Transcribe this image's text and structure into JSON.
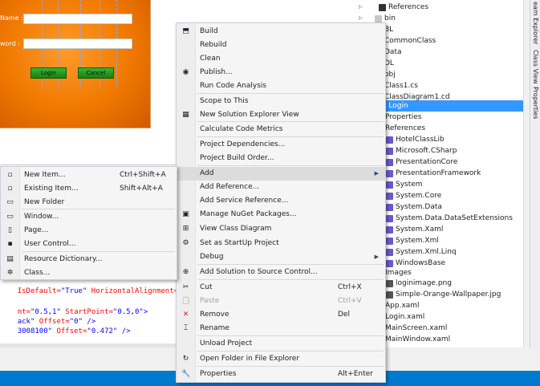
{
  "designer": {
    "name_label": "Name :",
    "password_label": "word :",
    "login_button": "Login",
    "cancel_button": "Cancel"
  },
  "code": {
    "line1_attr": "IsDefault=",
    "line1_val": "\"True\"",
    "line1_attr2": " HorizontalAlignment=",
    "line2_a": "nt=",
    "line2_b": "\"0.5,1\"",
    "line2_c": " StartPoint=",
    "line2_d": "\"0.5,0\"",
    "line2_e": ">",
    "line3_a": "ack\"",
    "line3_b": " Offset=",
    "line3_c": "\"0\"",
    "line3_d": " />",
    "line4_a": "3008100\"",
    "line4_b": " Offset=",
    "line4_c": "\"0.472\"",
    "line4_d": " />"
  },
  "solution_tree": [
    {
      "label": "References",
      "arrow": "right",
      "icon": "references-icon"
    },
    {
      "label": "bin",
      "arrow": "right",
      "icon": "folder-icon"
    },
    {
      "label": "BL",
      "arrow": "",
      "icon": ""
    },
    {
      "label": "CommonClass",
      "arrow": "",
      "icon": ""
    },
    {
      "label": "Data",
      "arrow": "",
      "icon": ""
    },
    {
      "label": "DL",
      "arrow": "",
      "icon": ""
    },
    {
      "label": "obj",
      "arrow": "",
      "icon": ""
    },
    {
      "label": "Class1.cs",
      "arrow": "",
      "icon": ""
    },
    {
      "label": "ClassDiagram1.cd",
      "arrow": "",
      "icon": ""
    },
    {
      "label": "t Login",
      "arrow": "",
      "icon": "",
      "selected": true
    },
    {
      "label": "Properties",
      "arrow": "",
      "icon": ""
    },
    {
      "label": "References",
      "arrow": "",
      "icon": ""
    },
    {
      "label": "HotelClassLib",
      "arrow": "",
      "icon": "reference-icon"
    },
    {
      "label": "Microsoft.CSharp",
      "arrow": "",
      "icon": "reference-icon"
    },
    {
      "label": "PresentationCore",
      "arrow": "",
      "icon": "reference-icon"
    },
    {
      "label": "PresentationFramework",
      "arrow": "",
      "icon": "reference-icon"
    },
    {
      "label": "System",
      "arrow": "",
      "icon": "reference-icon"
    },
    {
      "label": "System.Core",
      "arrow": "",
      "icon": "reference-icon"
    },
    {
      "label": "System.Data",
      "arrow": "",
      "icon": "reference-icon"
    },
    {
      "label": "System.Data.DataSetExtensions",
      "arrow": "",
      "icon": "reference-icon"
    },
    {
      "label": "System.Xaml",
      "arrow": "",
      "icon": "reference-icon"
    },
    {
      "label": "System.Xml",
      "arrow": "",
      "icon": "reference-icon"
    },
    {
      "label": "System.Xml.Linq",
      "arrow": "",
      "icon": "reference-icon"
    },
    {
      "label": "WindowsBase",
      "arrow": "",
      "icon": "reference-icon"
    },
    {
      "label": "Images",
      "arrow": "",
      "icon": ""
    },
    {
      "label": "loginimage.png",
      "arrow": "",
      "icon": "image-file-icon"
    },
    {
      "label": "Simple-Orange-Wallpaper.jpg",
      "arrow": "",
      "icon": "image-file-icon"
    },
    {
      "label": "App.xaml",
      "arrow": "",
      "icon": ""
    },
    {
      "label": "Login.xaml",
      "arrow": "",
      "icon": ""
    },
    {
      "label": "MainScreen.xaml",
      "arrow": "",
      "icon": ""
    },
    {
      "label": "MainWindow.xaml",
      "arrow": "",
      "icon": ""
    }
  ],
  "side_tabs": {
    "team_explorer": "eam Explorer",
    "class_view": "Class View",
    "properties": "Properties"
  },
  "context_menu": {
    "items": [
      {
        "name": "build",
        "label": "Build",
        "icon": "build-icon",
        "glyph": "⬒",
        "shortcut": "",
        "submenu": false,
        "disabled": false
      },
      {
        "name": "rebuild",
        "label": "Rebuild",
        "icon": "",
        "glyph": "",
        "shortcut": "",
        "submenu": false,
        "disabled": false
      },
      {
        "name": "clean",
        "label": "Clean",
        "icon": "",
        "glyph": "",
        "shortcut": "",
        "submenu": false,
        "disabled": false
      },
      {
        "name": "publish",
        "label": "Publish...",
        "icon": "publish-globe-icon",
        "glyph": "◉",
        "shortcut": "",
        "submenu": false,
        "disabled": false
      },
      {
        "name": "run-code-analysis",
        "label": "Run Code Analysis",
        "icon": "",
        "glyph": "",
        "shortcut": "",
        "submenu": false,
        "disabled": false
      },
      {
        "name": "scope-to-this",
        "label": "Scope to This",
        "icon": "",
        "glyph": "",
        "shortcut": "",
        "submenu": false,
        "disabled": false
      },
      {
        "name": "new-solution-explorer-view",
        "label": "New Solution Explorer View",
        "icon": "solution-explorer-view-icon",
        "glyph": "▦",
        "shortcut": "",
        "submenu": false,
        "disabled": false
      },
      {
        "name": "calculate-code-metrics",
        "label": "Calculate Code Metrics",
        "icon": "",
        "glyph": "",
        "shortcut": "",
        "submenu": false,
        "disabled": false
      },
      {
        "name": "project-dependencies",
        "label": "Project Dependencies...",
        "icon": "",
        "glyph": "",
        "shortcut": "",
        "submenu": false,
        "disabled": false
      },
      {
        "name": "project-build-order",
        "label": "Project Build Order...",
        "icon": "",
        "glyph": "",
        "shortcut": "",
        "submenu": false,
        "disabled": false
      },
      {
        "name": "add",
        "label": "Add",
        "icon": "",
        "glyph": "",
        "shortcut": "",
        "submenu": true,
        "disabled": false,
        "highlight": true
      },
      {
        "name": "add-reference",
        "label": "Add Reference...",
        "icon": "",
        "glyph": "",
        "shortcut": "",
        "submenu": false,
        "disabled": false
      },
      {
        "name": "add-service-reference",
        "label": "Add Service Reference...",
        "icon": "",
        "glyph": "",
        "shortcut": "",
        "submenu": false,
        "disabled": false
      },
      {
        "name": "manage-nuget-packages",
        "label": "Manage NuGet Packages...",
        "icon": "nuget-icon",
        "glyph": "▣",
        "shortcut": "",
        "submenu": false,
        "disabled": false
      },
      {
        "name": "view-class-diagram",
        "label": "View Class Diagram",
        "icon": "class-diagram-icon",
        "glyph": "⊞",
        "shortcut": "",
        "submenu": false,
        "disabled": false
      },
      {
        "name": "set-as-startup-project",
        "label": "Set as StartUp Project",
        "icon": "startup-project-icon",
        "glyph": "⚙",
        "shortcut": "",
        "submenu": false,
        "disabled": false
      },
      {
        "name": "debug",
        "label": "Debug",
        "icon": "",
        "glyph": "",
        "shortcut": "",
        "submenu": true,
        "disabled": false
      },
      {
        "name": "add-solution-to-source-control",
        "label": "Add Solution to Source Control...",
        "icon": "source-control-icon",
        "glyph": "⊕",
        "shortcut": "",
        "submenu": false,
        "disabled": false
      },
      {
        "name": "cut",
        "label": "Cut",
        "icon": "cut-icon",
        "glyph": "✂",
        "shortcut": "Ctrl+X",
        "submenu": false,
        "disabled": false
      },
      {
        "name": "paste",
        "label": "Paste",
        "icon": "paste-icon",
        "glyph": "📋",
        "shortcut": "Ctrl+V",
        "submenu": false,
        "disabled": true
      },
      {
        "name": "remove",
        "label": "Remove",
        "icon": "remove-icon",
        "glyph": "✕",
        "shortcut": "Del",
        "submenu": false,
        "disabled": false
      },
      {
        "name": "rename",
        "label": "Rename",
        "icon": "rename-icon",
        "glyph": "⌶",
        "shortcut": "",
        "submenu": false,
        "disabled": false
      },
      {
        "name": "unload-project",
        "label": "Unload Project",
        "icon": "",
        "glyph": "",
        "shortcut": "",
        "submenu": false,
        "disabled": false
      },
      {
        "name": "open-folder-in-file-explorer",
        "label": "Open Folder in File Explorer",
        "icon": "open-folder-icon",
        "glyph": "↻",
        "shortcut": "",
        "submenu": false,
        "disabled": false
      },
      {
        "name": "properties",
        "label": "Properties",
        "icon": "properties-wrench-icon",
        "glyph": "🔧",
        "shortcut": "Alt+Enter",
        "submenu": false,
        "disabled": false
      }
    ]
  },
  "add_submenu": {
    "items": [
      {
        "name": "new-item",
        "label": "New Item...",
        "icon": "new-item-icon",
        "glyph": "▫",
        "shortcut": "Ctrl+Shift+A"
      },
      {
        "name": "existing-item",
        "label": "Existing Item...",
        "icon": "existing-item-icon",
        "glyph": "▫",
        "shortcut": "Shift+Alt+A"
      },
      {
        "name": "new-folder",
        "label": "New Folder",
        "icon": "new-folder-icon",
        "glyph": "▭",
        "shortcut": ""
      },
      {
        "name": "window",
        "label": "Window...",
        "icon": "window-icon",
        "glyph": "▭",
        "shortcut": ""
      },
      {
        "name": "page",
        "label": "Page...",
        "icon": "page-icon",
        "glyph": "▯",
        "shortcut": ""
      },
      {
        "name": "user-control",
        "label": "User Control...",
        "icon": "user-control-icon",
        "glyph": "▪",
        "shortcut": ""
      },
      {
        "name": "resource-dictionary",
        "label": "Resource Dictionary...",
        "icon": "resource-dictionary-icon",
        "glyph": "▤",
        "shortcut": ""
      },
      {
        "name": "class",
        "label": "Class...",
        "icon": "class-icon",
        "glyph": "✲",
        "shortcut": ""
      }
    ]
  },
  "colors": {
    "accent": "#007acc",
    "selection": "#3399ff",
    "menu_highlight": "#dcdcdc",
    "orange": "#f07800"
  }
}
